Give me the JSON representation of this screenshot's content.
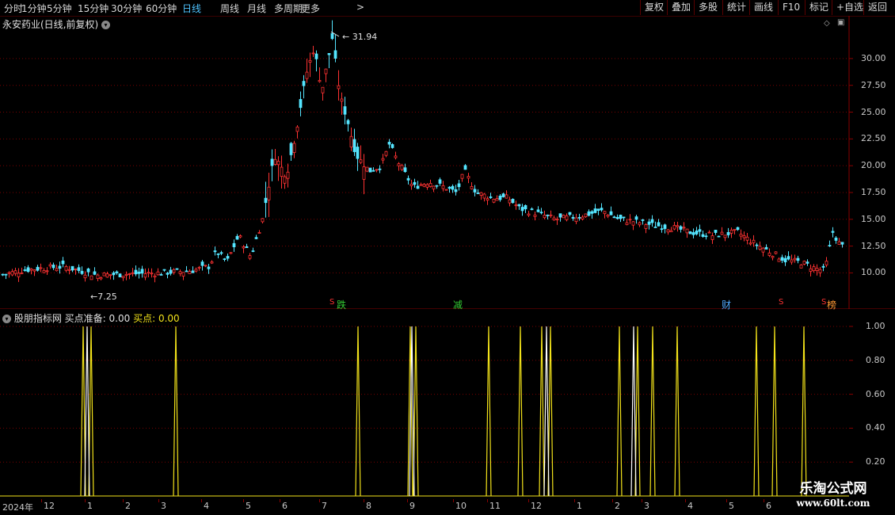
{
  "toolbar": {
    "periods": [
      "分时",
      "1分钟",
      "5分钟",
      "15分钟",
      "30分钟",
      "60分钟",
      "日线",
      "周线",
      "月线",
      "多周期",
      "更多"
    ],
    "active": "日线",
    "more_arrow": ">",
    "actions": [
      "复权",
      "叠加",
      "多股",
      "统计",
      "画线",
      "F10",
      "标记",
      "+自选",
      "返回"
    ]
  },
  "stock": {
    "title": "永安药业(日线,前复权)",
    "max_label": "31.94",
    "min_label": "7.25"
  },
  "main_axis": {
    "labels": [
      "30.00",
      "27.50",
      "25.00",
      "22.50",
      "20.00",
      "17.50",
      "15.00",
      "12.50",
      "10.00"
    ],
    "min": 7.0,
    "max": 32.8
  },
  "events": [
    {
      "text": "跌",
      "color": "#33cc33"
    },
    {
      "text": "减",
      "color": "#33cc33"
    },
    {
      "text": "财",
      "color": "#4fa8ff"
    },
    {
      "text": "榜",
      "color": "#ff9933"
    }
  ],
  "event_s": "S",
  "indicator": {
    "name": "股朋指标网",
    "buy_prep_label": "买点准备:",
    "buy_prep_value": "0.00",
    "buy_label": "买点:",
    "buy_value": "0.00",
    "axis_labels": [
      "1.00",
      "0.80",
      "0.60",
      "0.40",
      "0.20"
    ]
  },
  "dates": [
    "2024年",
    "12",
    "1",
    "2",
    "3",
    "4",
    "5",
    "6",
    "7",
    "8",
    "9",
    "10",
    "11",
    "12",
    "1",
    "2",
    "3",
    "4",
    "5",
    "6"
  ],
  "watermark": {
    "line1": "乐淘公式网",
    "line2": "www.60lt.com"
  },
  "chart_data": [
    {
      "type": "candlestick",
      "title": "永安药业(日线,前复权)",
      "ylim": [
        7.0,
        32.8
      ],
      "y_ticks": [
        10.0,
        12.5,
        15.0,
        17.5,
        20.0,
        22.5,
        25.0,
        27.5,
        30.0
      ],
      "close_path": [
        [
          0,
          9.8
        ],
        [
          30,
          10.3
        ],
        [
          80,
          10.6
        ],
        [
          120,
          9.8
        ],
        [
          160,
          9.9
        ],
        [
          200,
          10.0
        ],
        [
          240,
          10.2
        ],
        [
          262,
          10.6
        ],
        [
          272,
          12.0
        ],
        [
          285,
          11.0
        ],
        [
          300,
          13.5
        ],
        [
          315,
          11.5
        ],
        [
          330,
          15.0
        ],
        [
          345,
          21.0
        ],
        [
          360,
          19.0
        ],
        [
          372,
          23.0
        ],
        [
          385,
          28.5
        ],
        [
          395,
          31.0
        ],
        [
          405,
          27.0
        ],
        [
          418,
          31.9
        ],
        [
          428,
          26.5
        ],
        [
          438,
          24.0
        ],
        [
          448,
          21.0
        ],
        [
          465,
          19.5
        ],
        [
          480,
          20.0
        ],
        [
          490,
          22.0
        ],
        [
          500,
          20.5
        ],
        [
          520,
          18.0
        ],
        [
          540,
          18.5
        ],
        [
          560,
          18.0
        ],
        [
          575,
          17.5
        ],
        [
          585,
          19.5
        ],
        [
          600,
          17.5
        ],
        [
          620,
          17.0
        ],
        [
          640,
          17.0
        ],
        [
          655,
          16.0
        ],
        [
          680,
          15.5
        ],
        [
          700,
          15.0
        ],
        [
          730,
          15.3
        ],
        [
          760,
          15.8
        ],
        [
          780,
          15.0
        ],
        [
          800,
          14.8
        ],
        [
          820,
          14.5
        ],
        [
          850,
          14.2
        ],
        [
          870,
          13.8
        ],
        [
          900,
          13.5
        ],
        [
          930,
          13.8
        ],
        [
          950,
          12.8
        ],
        [
          970,
          12.0
        ],
        [
          990,
          11.2
        ],
        [
          1010,
          11.0
        ],
        [
          1025,
          10.5
        ],
        [
          1040,
          10.2
        ],
        [
          1050,
          13.8
        ],
        [
          1060,
          12.5
        ]
      ],
      "max_marker": 31.94,
      "min_marker": 7.25
    },
    {
      "type": "line",
      "title": "股朋指标网",
      "ylim": [
        0,
        1.0
      ],
      "y_ticks": [
        0.2,
        0.4,
        0.6,
        0.8,
        1.0
      ],
      "series": [
        {
          "name": "买点准备",
          "color": "#f2e21a",
          "spike_x": [
            105,
            115,
            222,
            452,
            518,
            525,
            617,
            657,
            684,
            695,
            782,
            805,
            824,
            855,
            955,
            978,
            1015
          ]
        },
        {
          "name": "买点",
          "color": "#ffffff",
          "spike_x": [
            110,
            520,
            690,
            800
          ]
        }
      ]
    }
  ]
}
